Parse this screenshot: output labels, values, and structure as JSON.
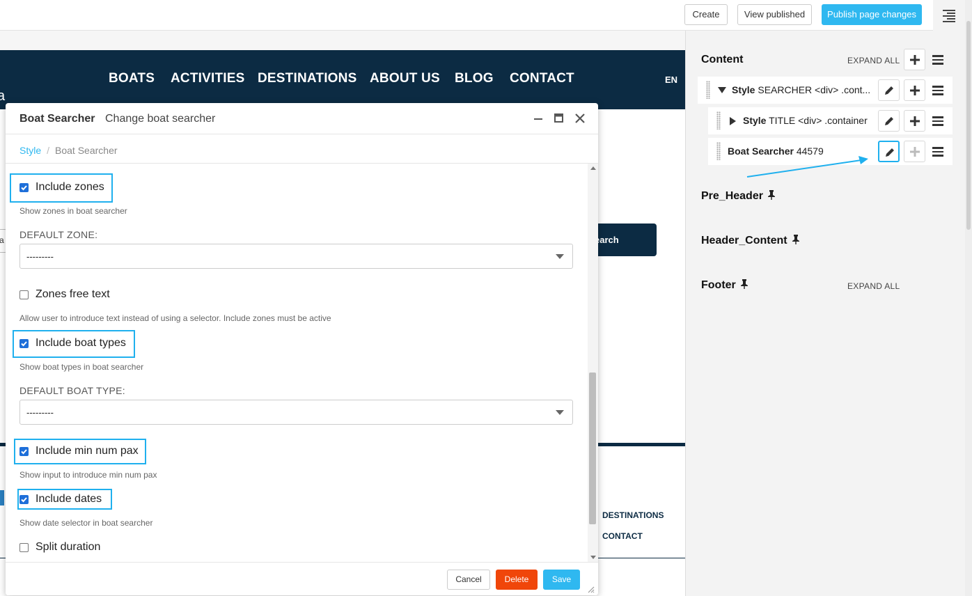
{
  "toolbar": {
    "create_label": "Create",
    "view_published_label": "View published",
    "publish_label": "Publish page changes",
    "publish_color": "#2fb8f0",
    "toggle_icon": "right-aligned-lines-icon"
  },
  "site": {
    "nav": {
      "links": [
        "BOATS",
        "ACTIVITIES",
        "DESTINATIONS",
        "ABOUT US",
        "BLOG",
        "CONTACT"
      ],
      "language": "EN",
      "edge_letter": "a",
      "bg_color": "#0c2b43"
    },
    "search_button": "earch",
    "search_field_edge": "a",
    "footer_links": [
      "DESTINATIONS",
      "CONTACT"
    ]
  },
  "panel": {
    "content_title": "Content",
    "expand_all": "EXPAND ALL",
    "tree": [
      {
        "kind": "Style",
        "desc": "SEARCHER <div> .cont...",
        "expanded": true
      },
      {
        "kind": "Style",
        "desc": "TITLE <div> .container",
        "expanded": false
      },
      {
        "kind": "Boat Searcher",
        "desc": "44579"
      }
    ],
    "sections": [
      {
        "title": "Pre_Header",
        "icon": "pin-icon"
      },
      {
        "title": "Header_Content",
        "icon": "pin-icon"
      },
      {
        "title": "Footer",
        "icon": "pin-icon",
        "expand_all": "EXPAND ALL"
      }
    ],
    "highlight_color": "#1fb0ee"
  },
  "modal": {
    "title": "Boat Searcher",
    "subtitle": "Change boat searcher",
    "breadcrumb": [
      "Style",
      "Boat Searcher"
    ],
    "fields": {
      "include_zones": {
        "label": "Include zones",
        "checked": true,
        "help": "Show zones in boat searcher"
      },
      "default_zone": {
        "label": "DEFAULT ZONE:",
        "value": "---------"
      },
      "zones_free_text": {
        "label": "Zones free text",
        "checked": false,
        "help": "Allow user to introduce text instead of using a selector. Include zones must be active"
      },
      "include_boat_types": {
        "label": "Include boat types",
        "checked": true,
        "help": "Show boat types in boat searcher"
      },
      "default_boat_type": {
        "label": "DEFAULT BOAT TYPE:",
        "value": "---------"
      },
      "include_min_num_pax": {
        "label": "Include min num pax",
        "checked": true,
        "help": "Show input to introduce min num pax"
      },
      "include_dates": {
        "label": "Include dates",
        "checked": true,
        "help": "Show date selector in boat searcher"
      },
      "split_duration": {
        "label": "Split duration",
        "checked": false
      }
    },
    "footer": {
      "cancel_label": "Cancel",
      "delete_label": "Delete",
      "save_label": "Save",
      "delete_color": "#f0460a",
      "save_color": "#2fb8f0"
    }
  }
}
